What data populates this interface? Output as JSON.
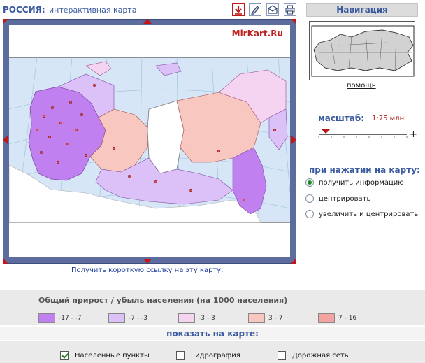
{
  "header": {
    "title": "РОССИЯ:",
    "subtitle": "интерактивная карта",
    "tools": [
      {
        "name": "download-icon",
        "color": "#c01818"
      },
      {
        "name": "pencil-icon"
      },
      {
        "name": "envelope-icon"
      },
      {
        "name": "printer-icon"
      }
    ]
  },
  "map": {
    "brand": "MirKart.Ru",
    "short_link": "Получить короткую ссылку на эту карту."
  },
  "navigation": {
    "title": "Навигация",
    "help": "помощь"
  },
  "scale": {
    "label": "масштаб:",
    "value": "1:75 млн.",
    "minus": "–",
    "plus": "+",
    "slider_level": 0.08
  },
  "click_action": {
    "title": "при нажатии на карту:",
    "options": [
      {
        "label": "получить информацию",
        "selected": true
      },
      {
        "label": "центрировать",
        "selected": false
      },
      {
        "label": "увеличить и центрировать",
        "selected": false
      }
    ]
  },
  "legend": {
    "title": "Общий прирост / убыль населения (на 1000 населения)",
    "items": [
      {
        "label": "-17 - -7",
        "color": "#c080f0"
      },
      {
        "label": "-7 - -3",
        "color": "#dcc0f8"
      },
      {
        "label": "-3 - 3",
        "color": "#f4d4f0"
      },
      {
        "label": "3 - 7",
        "color": "#f8c8c0"
      },
      {
        "label": "7 - 16",
        "color": "#f4a4a0"
      }
    ]
  },
  "show_on_map": {
    "title": "показать на карте:",
    "layers": [
      {
        "label": "Населенные пункты",
        "checked": true
      },
      {
        "label": "Гидрография",
        "checked": false
      },
      {
        "label": "Дорожная сеть",
        "checked": false
      }
    ]
  }
}
